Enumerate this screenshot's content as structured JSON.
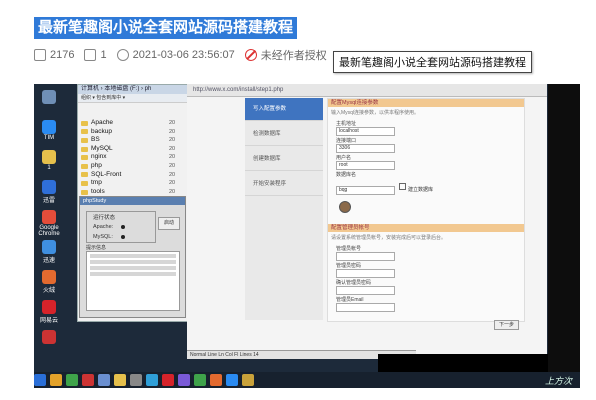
{
  "article": {
    "title": "最新笔趣阁小说全套网站源码搭建教程",
    "tooltip": "最新笔趣阁小说全套网站源码搭建教程",
    "stats": {
      "views": "2176",
      "comments": "1",
      "datetime": "2021-03-06 23:56:07",
      "notice": "未经作者授权"
    }
  },
  "screen": {
    "desktop_icons": [
      {
        "label": "",
        "icon": "recycle-bin-icon",
        "color": "#6f8fb6"
      },
      {
        "label": "TIM",
        "icon": "tim-icon",
        "color": "#2a8bf2"
      },
      {
        "label": "1",
        "icon": "file-icon",
        "color": "#e6c04c"
      },
      {
        "label": "迅雷",
        "icon": "thunder-icon",
        "color": "#2f6fd8"
      },
      {
        "label": "Google Chrome",
        "icon": "chrome-icon",
        "color": "#e44d3a"
      },
      {
        "label": "迅速",
        "icon": "app-icon",
        "color": "#3f8fe0"
      },
      {
        "label": "火绒",
        "icon": "huorong-icon",
        "color": "#e36a2f"
      },
      {
        "label": "网易云",
        "icon": "netease-icon",
        "color": "#d6232a"
      },
      {
        "label": "",
        "icon": "app-icon",
        "color": "#c33"
      }
    ],
    "explorer": {
      "title": "计算机 › 本地磁盘 (F:) › ph",
      "toolbar": "组织 ▾  包含到库中 ▾",
      "folders": [
        {
          "name": "Apache",
          "size": "20"
        },
        {
          "name": "backup",
          "size": "20"
        },
        {
          "name": "BS",
          "size": "20"
        },
        {
          "name": "MySQL",
          "size": "20"
        },
        {
          "name": "nginx",
          "size": "20"
        },
        {
          "name": "php",
          "size": "20"
        },
        {
          "name": "SQL-Front",
          "size": "20"
        },
        {
          "name": "tmp",
          "size": "20"
        },
        {
          "name": "tools",
          "size": "20"
        },
        {
          "name": "WWW",
          "size": "20"
        }
      ]
    },
    "control": {
      "title": "phpStudy",
      "status_label": "运行状态",
      "apache_label": "Apache:",
      "mysql_label": "MySQL:",
      "start_button": "启动",
      "log_label": "提示信息"
    },
    "browser": {
      "address": "http://www.x.com/install/step1.php",
      "nav": [
        "写入配置参数",
        "检测数据库",
        "创建数据库",
        "开始安装程序"
      ],
      "section1_title": "配置Mysql连接参数",
      "section1_desc": "输入Mysql连接参数，以供本程序使用。",
      "fields1": [
        {
          "label": "主机地址",
          "value": "localhost"
        },
        {
          "label": "连接端口",
          "value": "3306"
        },
        {
          "label": "用户名",
          "value": "root"
        },
        {
          "label": "数据库名",
          "value": "bqg"
        }
      ],
      "create_db_label": "建立数据库",
      "section2_title": "配置管理员帐号",
      "section2_desc": "请设置系统管理员帐号，安装完成后可以登录后台。",
      "fields2": [
        {
          "label": "管理员帐号",
          "value": ""
        },
        {
          "label": "管理员密码",
          "value": ""
        },
        {
          "label": "确认管理员密码",
          "value": ""
        },
        {
          "label": "管理员Email",
          "value": ""
        }
      ],
      "next_button": "下一步"
    },
    "statusbar": "Normal  Line  Ln  Col  Fl  Lines  14",
    "watermark": "上方次"
  }
}
